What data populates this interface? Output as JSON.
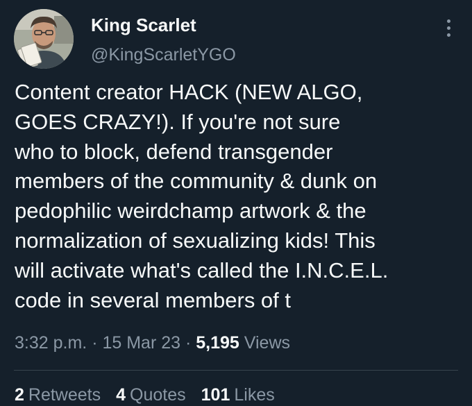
{
  "author": {
    "display_name": "King Scarlet",
    "handle": "@KingScarletYGO",
    "avatar_icon": "user-avatar"
  },
  "more_icon": "more-options-vertical-icon",
  "tweet": {
    "lines": [
      "Content creator HACK (NEW ALGO,",
      "GOES CRAZY!). If you're not sure",
      "who to block, defend transgender",
      "members of the community & dunk on",
      "pedophilic weirdchamp artwork & the",
      "normalization of sexualizing kids! This",
      "will activate what's called the I.N.C.E.L.",
      "code in several members of t"
    ]
  },
  "meta": {
    "time": "3:32 p.m.",
    "date": "15 Mar 23",
    "separator": "·",
    "views_count": "5,195",
    "views_label": "Views"
  },
  "stats": {
    "retweets_count": "2",
    "retweets_label": "Retweets",
    "quotes_count": "4",
    "quotes_label": "Quotes",
    "likes_count": "101",
    "likes_label": "Likes"
  },
  "colors": {
    "background": "#15202b",
    "primary_text": "#f7f9f9",
    "secondary_text": "#8b98a5",
    "divider": "#38444d"
  }
}
